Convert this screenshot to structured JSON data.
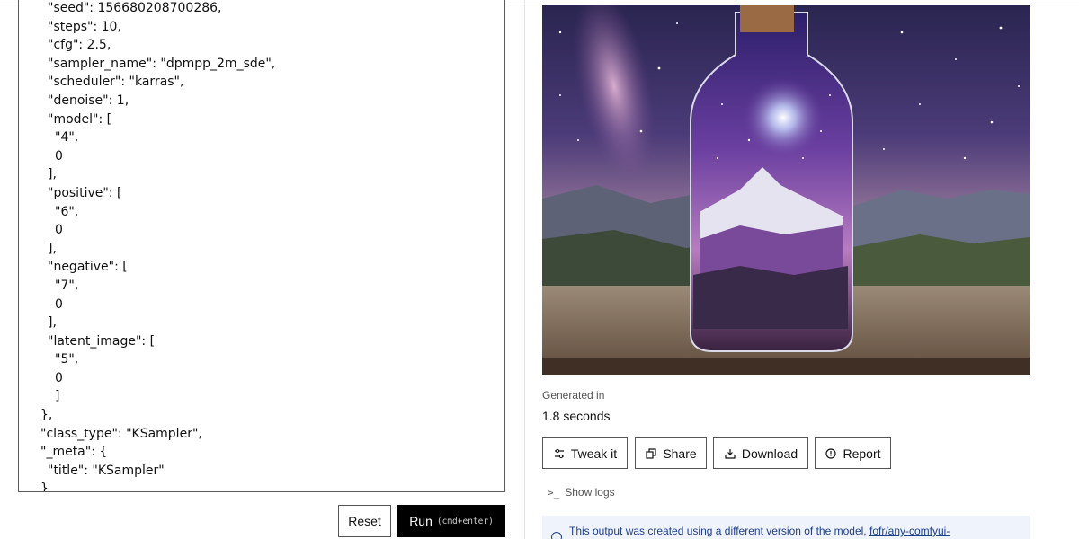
{
  "json_editor": {
    "lines": [
      {
        "text": "\"seed\": 156680208700286,",
        "indent": 1
      },
      {
        "text": "\"steps\": 10,",
        "indent": 1
      },
      {
        "text": "\"cfg\": 2.5,",
        "indent": 1
      },
      {
        "text": "\"sampler_name\": \"dpmpp_2m_sde\",",
        "indent": 1
      },
      {
        "text": "\"scheduler\": \"karras\",",
        "indent": 1
      },
      {
        "text": "\"denoise\": 1,",
        "indent": 1
      },
      {
        "text": "\"model\": [",
        "indent": 1
      },
      {
        "text": "\"4\",",
        "indent": 2
      },
      {
        "text": "0",
        "indent": 2
      },
      {
        "text": "],",
        "indent": 1
      },
      {
        "text": "\"positive\": [",
        "indent": 1
      },
      {
        "text": "\"6\",",
        "indent": 2
      },
      {
        "text": "0",
        "indent": 2
      },
      {
        "text": "],",
        "indent": 1
      },
      {
        "text": "\"negative\": [",
        "indent": 1
      },
      {
        "text": "\"7\",",
        "indent": 2
      },
      {
        "text": "0",
        "indent": 2
      },
      {
        "text": "],",
        "indent": 1
      },
      {
        "text": "\"latent_image\": [",
        "indent": 1
      },
      {
        "text": "\"5\",",
        "indent": 2
      },
      {
        "text": "0",
        "indent": 2
      },
      {
        "text": "]",
        "indent": 2
      },
      {
        "text": "},",
        "indent": 0
      },
      {
        "text": "\"class_type\": \"KSampler\",",
        "indent": 0
      },
      {
        "text": "\"_meta\": {",
        "indent": 0
      },
      {
        "text": "\"title\": \"KSampler\"",
        "indent": 1
      },
      {
        "text": "}",
        "indent": 0
      }
    ]
  },
  "controls": {
    "reset_label": "Reset",
    "run_label": "Run",
    "run_hint": "(cmd+enter)"
  },
  "output": {
    "generated_label": "Generated in",
    "generated_value": "1.8 seconds",
    "actions": {
      "tweak": "Tweak it",
      "share": "Share",
      "download": "Download",
      "report": "Report"
    },
    "show_logs": "Show logs",
    "notice_text": "This output was created using a different version of the model,",
    "notice_link": "fofr/any-comfyui-"
  },
  "colors": {
    "run_bg": "#000000",
    "notice_bg": "#eef3fc",
    "notice_text": "#1f3f8f"
  }
}
